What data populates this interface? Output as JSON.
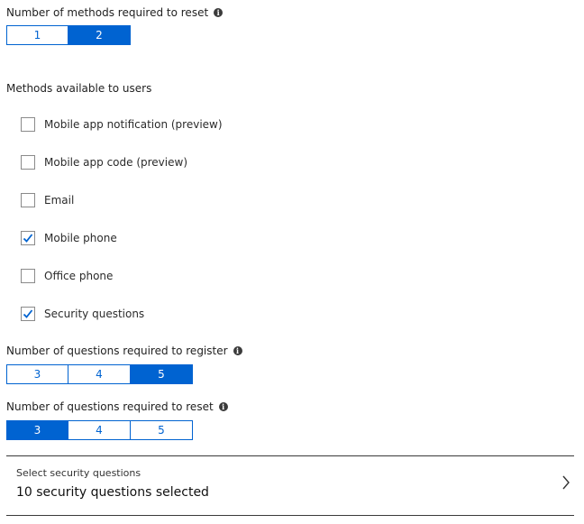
{
  "reset_methods_required": {
    "label": "Number of methods required to reset",
    "options": [
      "1",
      "2"
    ],
    "selected": "2"
  },
  "methods": {
    "heading": "Methods available to users",
    "items": [
      {
        "label": "Mobile app notification (preview)",
        "checked": false
      },
      {
        "label": "Mobile app code (preview)",
        "checked": false
      },
      {
        "label": "Email",
        "checked": false
      },
      {
        "label": "Mobile phone",
        "checked": true
      },
      {
        "label": "Office phone",
        "checked": false
      },
      {
        "label": "Security questions",
        "checked": true
      }
    ]
  },
  "questions_register": {
    "label": "Number of questions required to register",
    "options": [
      "3",
      "4",
      "5"
    ],
    "selected": "5"
  },
  "questions_reset": {
    "label": "Number of questions required to reset",
    "options": [
      "3",
      "4",
      "5"
    ],
    "selected": "3"
  },
  "security_questions": {
    "title": "Select security questions",
    "value": "10 security questions selected",
    "icon": "chevron-right-icon"
  },
  "colors": {
    "accent": "#0063d1",
    "divider": "#3a3a3a"
  }
}
